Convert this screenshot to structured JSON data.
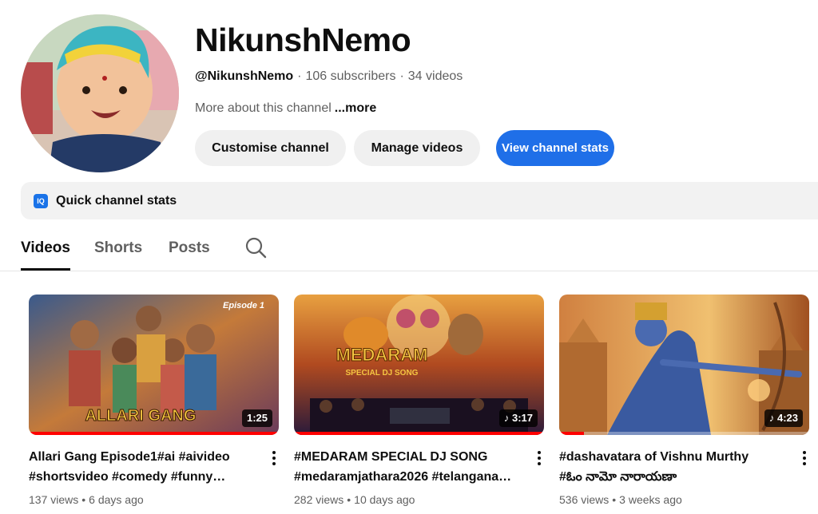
{
  "channel": {
    "name": "NikunshNemo",
    "handle": "@NikunshNemo",
    "subscribers": "106 subscribers",
    "videos": "34 videos",
    "about": "More about this channel",
    "more": "...more"
  },
  "actions": {
    "customise": "Customise channel",
    "manage": "Manage videos",
    "stats": "View channel stats"
  },
  "stats_bar": {
    "icon_text": "IQ",
    "label": "Quick channel stats"
  },
  "tabs": [
    {
      "label": "Videos",
      "active": true
    },
    {
      "label": "Shorts",
      "active": false
    },
    {
      "label": "Posts",
      "active": false
    }
  ],
  "videos": [
    {
      "title_line1": "Allari Gang Episode1#ai #aivideo",
      "title_line2": "#shortsvideo #comedy #funny…",
      "duration": "1:25",
      "music": false,
      "views": "137 views",
      "age": "6 days ago",
      "thumb_text_top": "Episode 1",
      "thumb_text_bottom": "ALLARI GANG",
      "progress": 1.0
    },
    {
      "title_line1": "#MEDARAM SPECIAL DJ SONG",
      "title_line2": "#medaramjathara2026 #telangana…",
      "duration": "3:17",
      "music": true,
      "views": "282 views",
      "age": "10 days ago",
      "thumb_text_top": "MEDARAM",
      "thumb_text_bottom": "SPECIAL DJ SONG",
      "progress": 1.0
    },
    {
      "title_line1": "#dashavatara of Vishnu Murthy",
      "title_line2": "#ఓం నామో నారాయణా",
      "duration": "4:23",
      "music": true,
      "views": "536 views",
      "age": "3 weeks ago",
      "progress": 0.02
    }
  ],
  "colors": {
    "accent": "#1f6fe8",
    "progress": "#ff0000",
    "text_secondary": "#606060"
  }
}
